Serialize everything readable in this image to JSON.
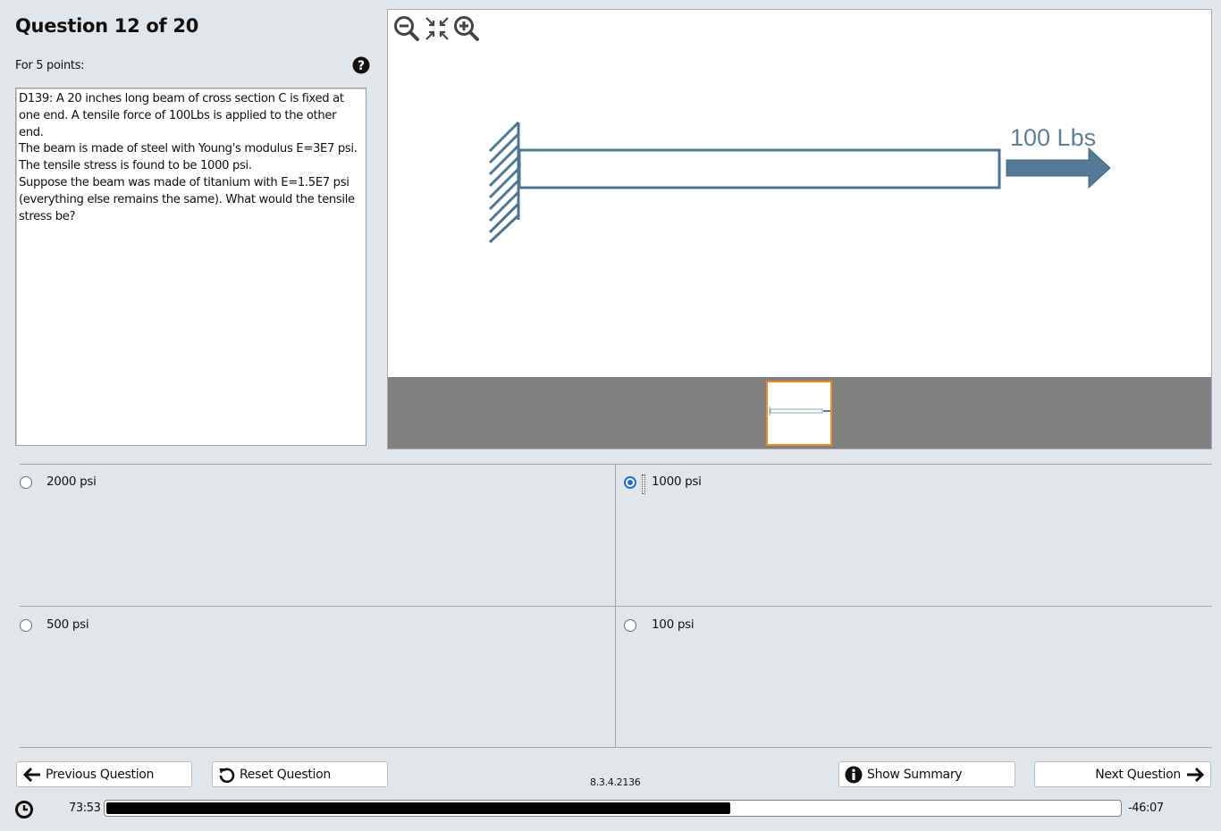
{
  "header": {
    "title": "Question 12 of 20",
    "points": "For 5 points:",
    "help_icon": "question-circle-icon"
  },
  "question": {
    "text": "D139: A 20 inches long beam of cross section C is fixed at one end. A tensile force of 100Lbs is applied to the other end.\nThe beam is made of steel with Young's modulus E=3E7 psi. The tensile stress is found to be 1000 psi.\nSuppose the beam was made of titanium with E=1.5E7 psi (everything else remains the same). What would the tensile stress be?"
  },
  "figure": {
    "force_label": "100 Lbs",
    "toolbar_icons": [
      "zoom-out-icon",
      "fit-to-screen-icon",
      "zoom-in-icon"
    ],
    "beam_color": "#4d7490",
    "arrow_color": "#527a95",
    "label_color": "#5e8099",
    "thumbnail_border": "#f08a1c"
  },
  "answers": [
    {
      "label": "2000 psi",
      "selected": false
    },
    {
      "label": "1000 psi",
      "selected": true
    },
    {
      "label": "500 psi",
      "selected": false
    },
    {
      "label": "100 psi",
      "selected": false
    }
  ],
  "nav": {
    "previous": "Previous Question",
    "reset": "Reset Question",
    "version": "8.3.4.2136",
    "summary": "Show Summary",
    "next": "Next Question"
  },
  "timer": {
    "elapsed": "73:53",
    "remaining": "-46:07",
    "progress_fraction": 0.6157
  },
  "colors": {
    "background": "#e3e6e9",
    "selected_radio": "#1a6fd1"
  }
}
